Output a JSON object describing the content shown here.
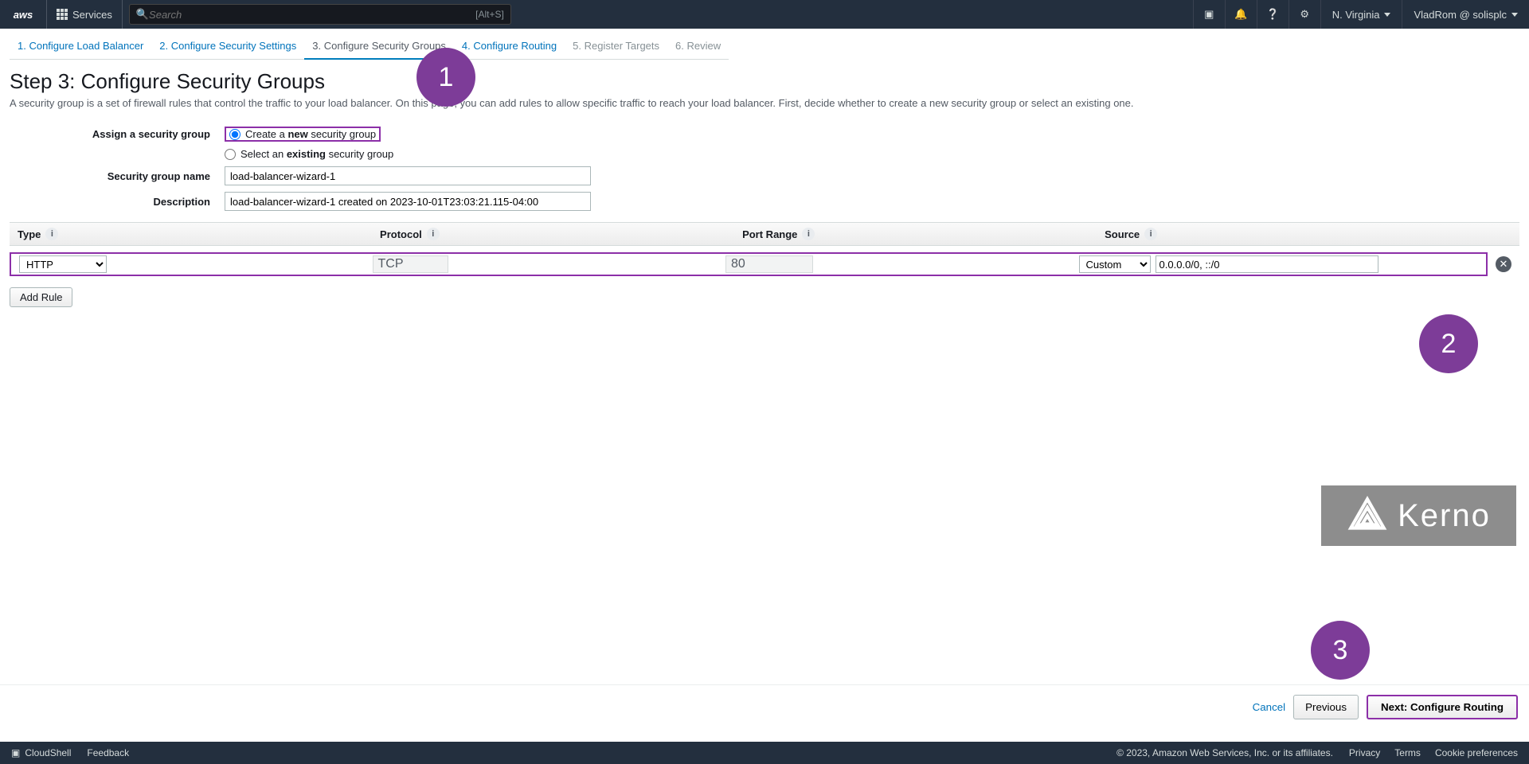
{
  "topnav": {
    "logo": "aws",
    "services_label": "Services",
    "search_placeholder": "Search",
    "search_shortcut": "[Alt+S]",
    "region": "N. Virginia",
    "user": "VladRom @ solisplc"
  },
  "steps": [
    "1. Configure Load Balancer",
    "2. Configure Security Settings",
    "3. Configure Security Groups",
    "4. Configure Routing",
    "5. Register Targets",
    "6. Review"
  ],
  "page": {
    "title": "Step 3: Configure Security Groups",
    "description": "A security group is a set of firewall rules that control the traffic to your load balancer. On this page, you can add rules to allow specific traffic to reach your load balancer. First, decide whether to create a new security group or select an existing one."
  },
  "assign": {
    "label": "Assign a security group",
    "option_new_before": "Create a ",
    "option_new_bold": "new",
    "option_new_after": " security group",
    "option_existing_before": "Select an ",
    "option_existing_bold": "existing",
    "option_existing_after": " security group"
  },
  "sg_name": {
    "label": "Security group name",
    "value": "load-balancer-wizard-1"
  },
  "sg_desc": {
    "label": "Description",
    "value": "load-balancer-wizard-1 created on 2023-10-01T23:03:21.115-04:00"
  },
  "table": {
    "headers": {
      "type": "Type",
      "protocol": "Protocol",
      "port": "Port Range",
      "source": "Source"
    },
    "row": {
      "type_value": "HTTP",
      "protocol": "TCP",
      "port": "80",
      "source_mode": "Custom",
      "source_cidr": "0.0.0.0/0, ::/0"
    },
    "add_rule": "Add Rule"
  },
  "annotations": {
    "a1": "1",
    "a2": "2",
    "a3": "3"
  },
  "watermark": "Kerno",
  "footer": {
    "cancel": "Cancel",
    "previous": "Previous",
    "next": "Next: Configure Routing"
  },
  "bottombar": {
    "cloudshell": "CloudShell",
    "feedback": "Feedback",
    "copyright": "© 2023, Amazon Web Services, Inc. or its affiliates.",
    "privacy": "Privacy",
    "terms": "Terms",
    "cookies": "Cookie preferences"
  }
}
